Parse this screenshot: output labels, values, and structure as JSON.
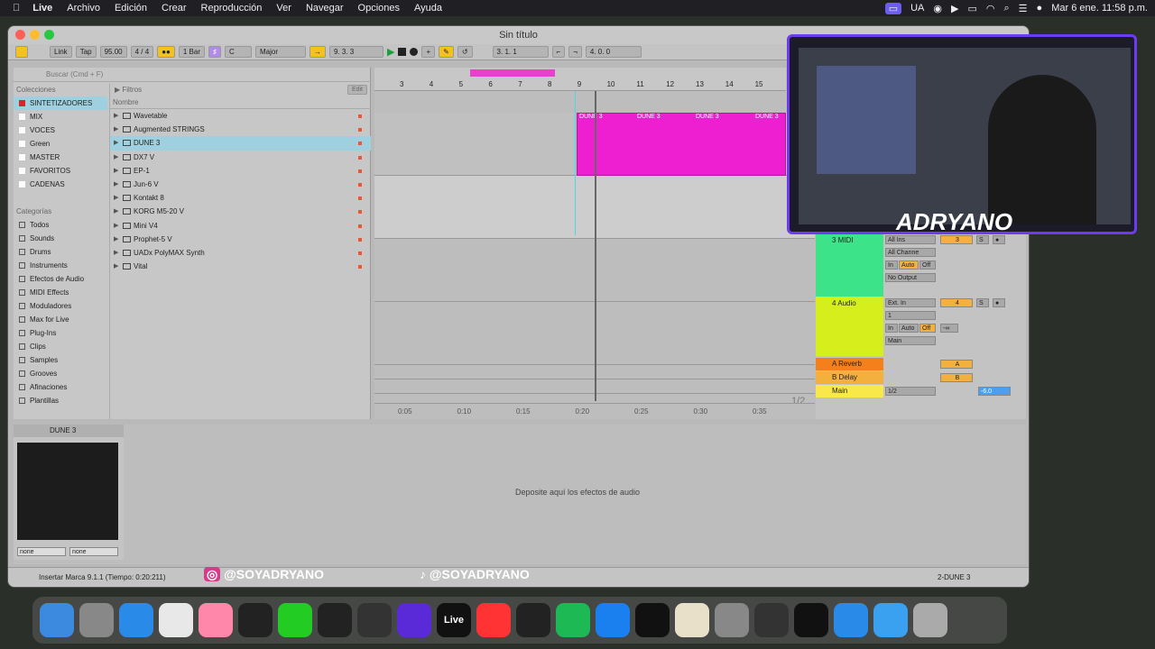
{
  "menubar": {
    "apple": "",
    "app": "Live",
    "items": [
      "Archivo",
      "Edición",
      "Crear",
      "Reproducción",
      "Ver",
      "Navegar",
      "Opciones",
      "Ayuda"
    ],
    "lang": "UA",
    "clock": "Mar 6 ene. 11:58 p.m."
  },
  "window": {
    "title": "Sin título"
  },
  "toolbar": {
    "link": "Link",
    "tap": "Tap",
    "bpm": "95.00",
    "sig": "4 / 4",
    "quant": "1 Bar",
    "key": "C",
    "scale": "Major",
    "pos": "9.   3.   3",
    "loop_start": "3.   1.   1",
    "loop_len": "4.   0.   0"
  },
  "browser": {
    "search_placeholder": "Buscar (Cmd + F)",
    "collections_header": "Colecciones",
    "collections": [
      {
        "label": "SINTETIZADORES",
        "color": "#e0202a"
      },
      {
        "label": "MIX",
        "color": "#ffffff"
      },
      {
        "label": "VOCES",
        "color": "#ffffff"
      },
      {
        "label": "Green",
        "color": "#ffffff"
      },
      {
        "label": "MASTER",
        "color": "#ffffff"
      },
      {
        "label": "FAVORITOS",
        "color": "#ffffff"
      },
      {
        "label": "CADENAS",
        "color": "#ffffff"
      }
    ],
    "categories_header": "Categorías",
    "categories": [
      "Todos",
      "Sounds",
      "Drums",
      "Instruments",
      "Efectos de Audio",
      "MIDI Effects",
      "Moduladores",
      "Max for Live",
      "Plug-Ins",
      "Clips",
      "Samples",
      "Grooves",
      "Afinaciones",
      "Plantillas"
    ],
    "filters": "Filtros",
    "edit": "Edit",
    "name_header": "Nombre",
    "items": [
      "Wavetable",
      "Augmented STRINGS",
      "DUNE 3",
      "DX7 V",
      "EP-1",
      "Jun-6 V",
      "Kontakt 8",
      "KORG M5-20 V",
      "Mini V4",
      "Prophet-5 V",
      "UADx PolyMAX Synth",
      "Vital"
    ]
  },
  "arrangement": {
    "ruler": [
      "3",
      "4",
      "5",
      "6",
      "7",
      "8",
      "9",
      "10",
      "11",
      "12",
      "13",
      "14",
      "15"
    ],
    "clip_label": "DUNE 3",
    "time_ticks": [
      "0:05",
      "0:10",
      "0:15",
      "0:20",
      "0:25",
      "0:30",
      "0:35"
    ],
    "page": "1/2"
  },
  "mixer": {
    "tracks": [
      {
        "name": "3 MIDI",
        "color": "#3ce389",
        "input": "All Ins",
        "channel": "All Channe",
        "monitor": [
          "In",
          "Auto",
          "Off"
        ],
        "output": "No Output",
        "num": "3"
      },
      {
        "name": "4 Audio",
        "color": "#d6ef1c",
        "input": "Ext. In",
        "channel": "1",
        "monitor": [
          "In",
          "Auto",
          "Off"
        ],
        "output": "Main",
        "num": "4",
        "vol": "-∞"
      }
    ],
    "returns": [
      {
        "name": "A Reverb",
        "color": "#f4801c",
        "letter": "A"
      },
      {
        "name": "B Delay",
        "color": "#f4b03c",
        "letter": "B"
      }
    ],
    "main": {
      "name": "Main",
      "color": "#f8e84a",
      "out": "1/2",
      "vol": "-6.0",
      "post": "Post"
    }
  },
  "device": {
    "name": "DUNE 3",
    "none1": "none",
    "none2": "none",
    "drop_text": "Deposite aquí los efectos de audio"
  },
  "status": {
    "message": "Insertar Marca 9.1.1 (Tiempo: 0:20:211)",
    "track": "2-DUNE 3"
  },
  "overlay": {
    "instagram": "@SOYADRYANO",
    "tiktok": "@SOYADRYANO",
    "brand": "ADRYANO"
  },
  "dock": [
    "Finder",
    "Launchpad",
    "Safari",
    "Chrome",
    "Photos",
    "Logic",
    "FaceTime",
    "KT",
    "Serato",
    "Ableton",
    "Live",
    "Music",
    "UA",
    "Spotify",
    "App Store",
    "TV",
    "Notes",
    "Settings",
    "Utility",
    "Keys",
    "Safari",
    "Folder",
    "Trash"
  ]
}
